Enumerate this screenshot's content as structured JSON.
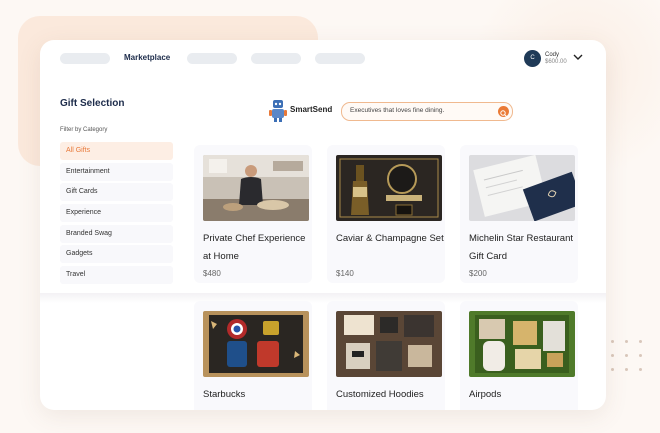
{
  "nav": {
    "active_label": "Marketplace",
    "user": {
      "initial": "C",
      "name": "Cody",
      "balance": "$600.00"
    }
  },
  "sidebar": {
    "title": "Gift Selection",
    "filter_label": "Filter by Category",
    "categories": [
      {
        "label": "All Gifts",
        "active": true
      },
      {
        "label": "Entertainment"
      },
      {
        "label": "Gift Cards"
      },
      {
        "label": "Experience"
      },
      {
        "label": "Branded Swag"
      },
      {
        "label": "Gadgets"
      },
      {
        "label": "Travel"
      }
    ]
  },
  "brand": {
    "name": "SmartSend"
  },
  "search": {
    "value": "Executives that loves fine dining."
  },
  "products": [
    {
      "name": "Private Chef Experience at Home",
      "price": "$480"
    },
    {
      "name": "Caviar & Champagne Set",
      "price": "$140"
    },
    {
      "name": "Michelin Star Restaurant Gift Card",
      "price": "$200"
    },
    {
      "name": "Starbucks",
      "price": ""
    },
    {
      "name": "Customized Hoodies",
      "price": ""
    },
    {
      "name": "Airpods",
      "price": ""
    }
  ],
  "colors": {
    "accent": "#ea7a36",
    "navy": "#1c2b4a"
  }
}
